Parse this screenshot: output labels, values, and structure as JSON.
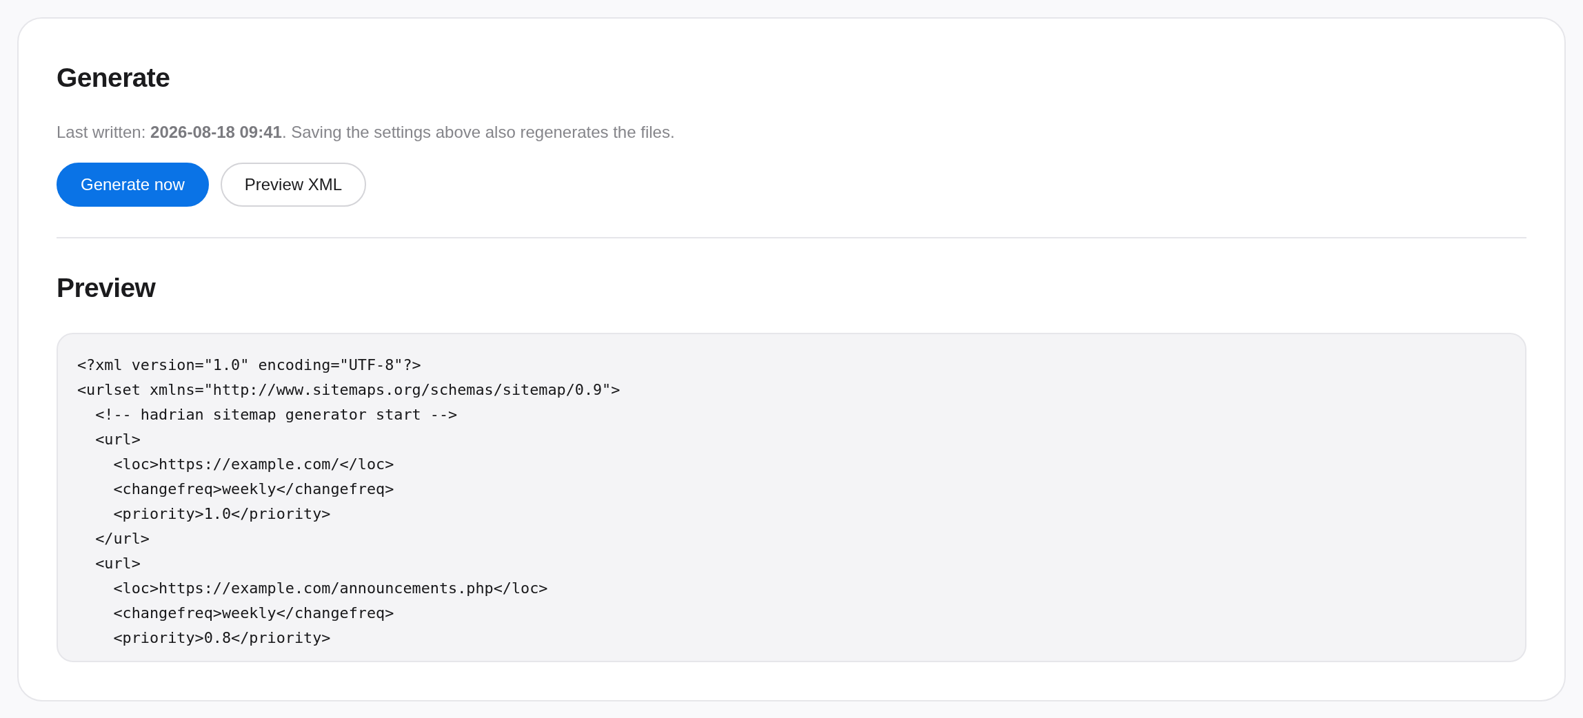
{
  "generate": {
    "title": "Generate",
    "status": "Last written: **2026-08-18 09:41**. Saving the settings above also regenerates the files.",
    "buttons": [
      {
        "label": "Generate now",
        "kind": "primary"
      },
      {
        "label": "Preview XML",
        "kind": "secondary"
      }
    ]
  },
  "preview": {
    "title": "Preview",
    "code_lines": [
      "<?xml version=\"1.0\" encoding=\"UTF-8\"?>",
      "<urlset xmlns=\"http://www.sitemaps.org/schemas/sitemap/0.9\">",
      "  <!-- hadrian sitemap generator start -->",
      "  <url>",
      "    <loc>https://example.com/</loc>",
      "    <changefreq>weekly</changefreq>",
      "    <priority>1.0</priority>",
      "  </url>",
      "  <url>",
      "    <loc>https://example.com/announcements.php</loc>",
      "    <changefreq>weekly</changefreq>",
      "    <priority>0.8</priority>"
    ]
  }
}
